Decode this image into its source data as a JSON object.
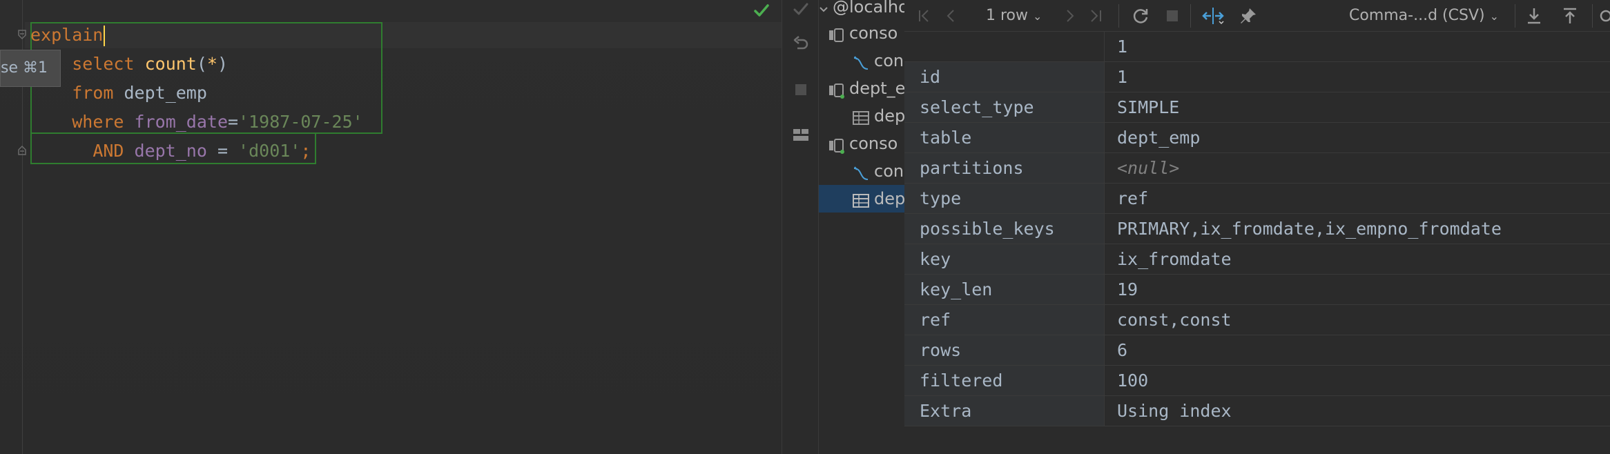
{
  "editor": {
    "code": {
      "line1": {
        "kw": "explain"
      },
      "line2": {
        "kw": "select",
        "fn": "count",
        "open": "(",
        "star": "*",
        "close": ")"
      },
      "line3": {
        "kw": "from",
        "table": "dept_emp"
      },
      "line4": {
        "kw": "where",
        "col": "from_date",
        "eq": "=",
        "val": "'1987-07-25'"
      },
      "line5": {
        "kw": "AND",
        "col": "dept_no",
        "eq": " = ",
        "val": "'d001'",
        "semi": ";"
      }
    },
    "tooltip": "se ⌘1"
  },
  "tree": {
    "items": [
      {
        "label": "@localho",
        "icon": "database-icon"
      },
      {
        "label": "conso",
        "icon": "console-icon"
      },
      {
        "label": "con",
        "icon": "sql-file-icon"
      },
      {
        "label": "dept_e",
        "icon": "console-icon"
      },
      {
        "label": "dep",
        "icon": "table-icon"
      },
      {
        "label": "conso",
        "icon": "console-icon"
      },
      {
        "label": "con",
        "icon": "sql-file-icon"
      },
      {
        "label": "dep",
        "icon": "table-icon"
      }
    ]
  },
  "results": {
    "toolbar": {
      "row_count": "1 row",
      "export_format": "Comma-...d (CSV)"
    },
    "column_header": "1",
    "rows": [
      {
        "key": "id",
        "value": "1"
      },
      {
        "key": "select_type",
        "value": "SIMPLE"
      },
      {
        "key": "table",
        "value": "dept_emp"
      },
      {
        "key": "partitions",
        "value": "<null>"
      },
      {
        "key": "type",
        "value": "ref"
      },
      {
        "key": "possible_keys",
        "value": "PRIMARY,ix_fromdate,ix_empno_fromdate"
      },
      {
        "key": "key",
        "value": "ix_fromdate"
      },
      {
        "key": "key_len",
        "value": "19"
      },
      {
        "key": "ref",
        "value": "const,const"
      },
      {
        "key": "rows",
        "value": "6"
      },
      {
        "key": "filtered",
        "value": "100"
      },
      {
        "key": "Extra",
        "value": "Using index"
      }
    ]
  },
  "colors": {
    "keyword": "#cc7832",
    "function": "#ffc66d",
    "column": "#9876aa",
    "string": "#6a8759",
    "selection": "#1f3e5e",
    "statement_border": "#2f7d2f"
  }
}
